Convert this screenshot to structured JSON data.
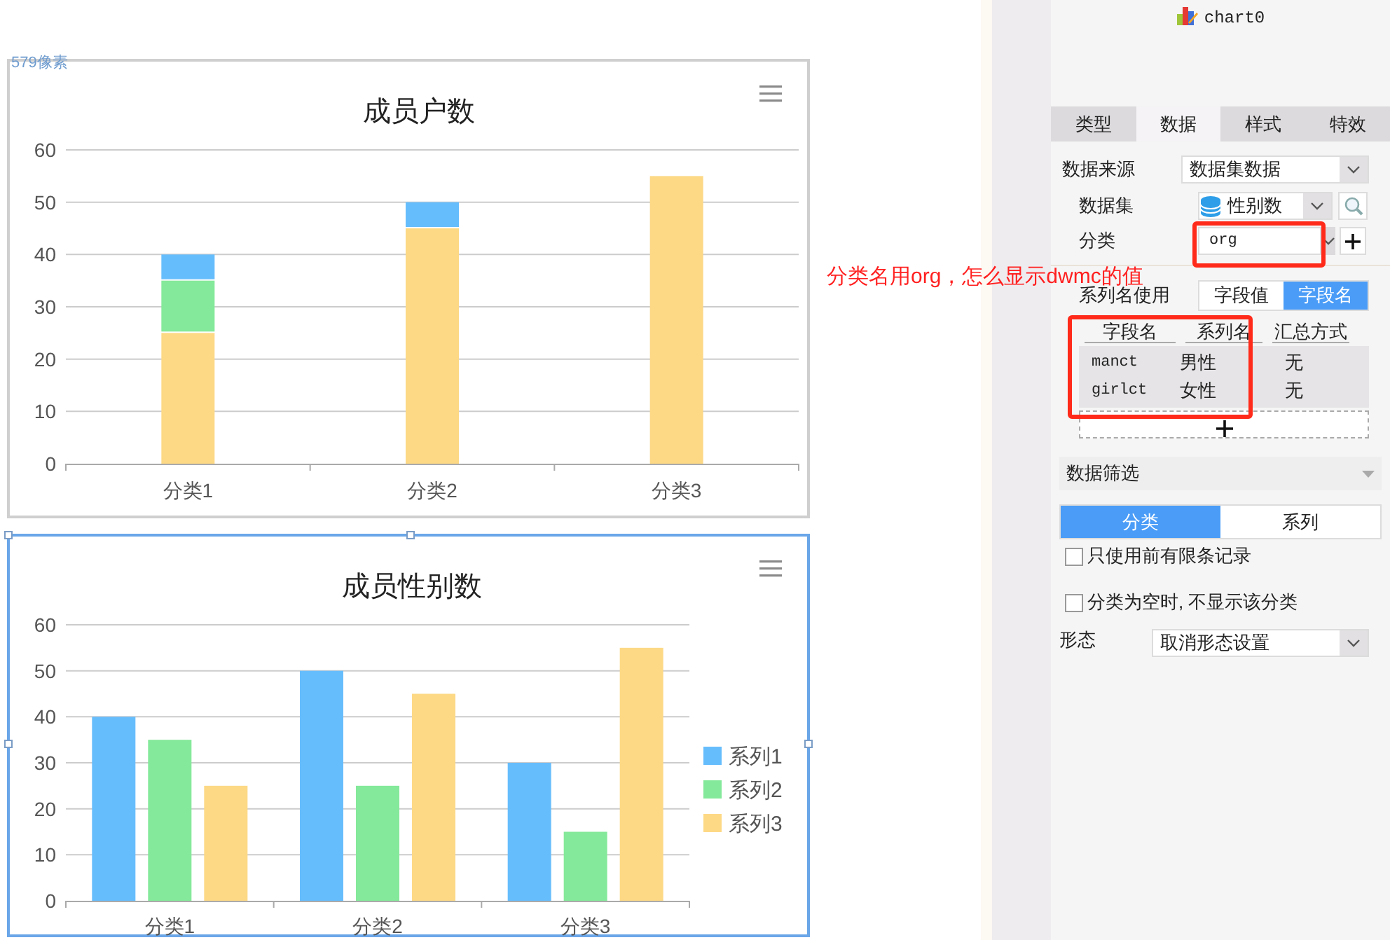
{
  "canvas": {
    "size_label": "579像素",
    "charts": [
      {
        "title": "成员户数",
        "kind": "single",
        "selected": false,
        "chart_data": {
          "type": "bar",
          "categories": [
            "分类1",
            "分类2",
            "分类3"
          ],
          "series": [
            {
              "color": "#fdd986",
              "values": [
                25,
                45,
                55
              ]
            },
            {
              "color": "#84e99a",
              "values": [
                10,
                null,
                null
              ]
            },
            {
              "color": "#66bdfc",
              "values": [
                5,
                5,
                null
              ]
            }
          ],
          "ylim": [
            0,
            60
          ],
          "yticks": [
            0,
            10,
            20,
            30,
            40,
            50,
            60
          ],
          "stacked": true,
          "grid": true
        }
      },
      {
        "title": "成员性别数",
        "kind": "with_legend",
        "selected": true,
        "chart_data": {
          "type": "bar",
          "categories": [
            "分类1",
            "分类2",
            "分类3"
          ],
          "legend": true,
          "grid": true,
          "series": [
            {
              "name": "系列1",
              "color": "#66bdfc",
              "values": [
                40,
                50,
                30
              ]
            },
            {
              "name": "系列2",
              "color": "#84e99a",
              "values": [
                35,
                25,
                15
              ]
            },
            {
              "name": "系列3",
              "color": "#fdd986",
              "values": [
                25,
                45,
                55
              ]
            }
          ],
          "ylim": [
            0,
            60
          ],
          "yticks": [
            0,
            10,
            20,
            30,
            40,
            50,
            60
          ],
          "stacked": false
        }
      }
    ]
  },
  "annotation": {
    "text": "分类名用org，怎么显示dwmc的值"
  },
  "panel": {
    "chart_name": "chart0",
    "tabs": [
      {
        "label": "类型",
        "selected": false
      },
      {
        "label": "数据",
        "selected": true
      },
      {
        "label": "样式",
        "selected": false
      },
      {
        "label": "特效",
        "selected": false
      }
    ],
    "data_source": {
      "label": "数据来源",
      "value": "数据集数据"
    },
    "dataset": {
      "label": "数据集",
      "value": "性别数"
    },
    "category": {
      "label": "分类",
      "value": "org"
    },
    "series_name_use": {
      "label": "系列名使用",
      "options": [
        {
          "label": "字段值",
          "selected": false
        },
        {
          "label": "字段名",
          "selected": true
        }
      ]
    },
    "field_table": {
      "columns": [
        "字段名",
        "系列名",
        "汇总方式"
      ],
      "rows": [
        [
          "manct",
          "男性",
          "无"
        ],
        [
          "girlct",
          "女性",
          "无"
        ]
      ]
    },
    "filter": {
      "title": "数据筛选",
      "tabs": [
        {
          "label": "分类",
          "selected": true
        },
        {
          "label": "系列",
          "selected": false
        }
      ],
      "checkboxes": [
        {
          "label": "只使用前有限条记录",
          "checked": false
        },
        {
          "label": "分类为空时, 不显示该分类",
          "checked": false
        }
      ]
    },
    "form": {
      "label": "形态",
      "value": "取消形态设置"
    }
  }
}
